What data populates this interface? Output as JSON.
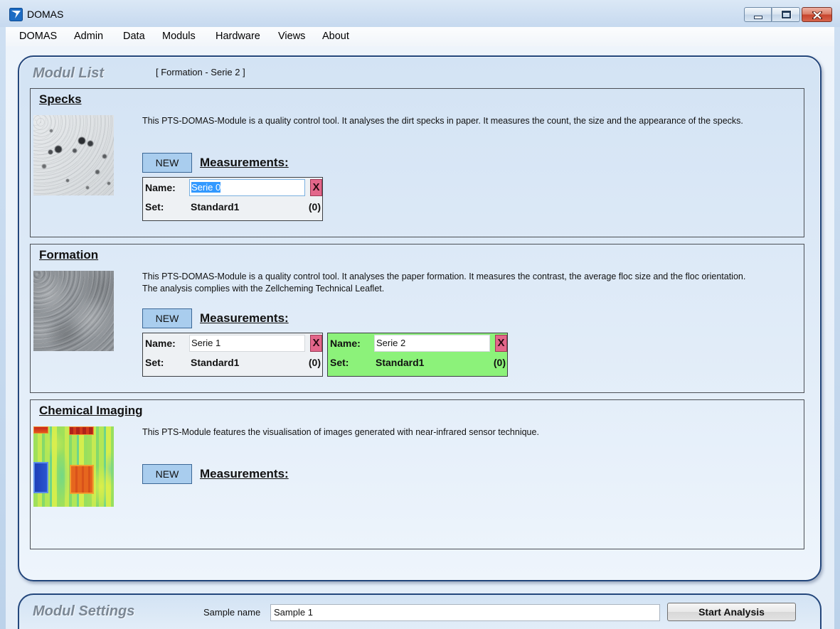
{
  "window": {
    "title": "DOMAS",
    "icon": "domas-logo-icon",
    "controls": [
      "minimize-icon",
      "maximize-icon",
      "close-icon"
    ]
  },
  "menu": {
    "items": [
      "DOMAS",
      "Admin",
      "Data",
      "Moduls",
      "Hardware",
      "Views",
      "About"
    ]
  },
  "modul_list": {
    "title": "Modul List",
    "context": "[ Formation - Serie 2 ]",
    "modules": [
      {
        "name": "Specks",
        "thumbnail": "specks-sample-image",
        "description_lines": [
          "This PTS-DOMAS-Module is a quality control tool. It analyses the dirt specks in paper. It measures the count, the size and the appearance of the specks."
        ],
        "new_label": "NEW",
        "measurements_label": "Measurements:",
        "measurements": [
          {
            "name_label": "Name:",
            "name_value": "Serie 0",
            "set_label": "Set:",
            "set_value": "Standard1",
            "count": "(0)",
            "delete_label": "X",
            "selected": false,
            "text_highlighted": true
          }
        ]
      },
      {
        "name": "Formation",
        "thumbnail": "formation-sample-image",
        "description_lines": [
          "This PTS-DOMAS-Module is a quality control tool. It analyses the paper formation. It measures the contrast, the average floc size and the floc orientation.",
          "The analysis complies with the Zellcheming Technical Leaflet."
        ],
        "new_label": "NEW",
        "measurements_label": "Measurements:",
        "measurements": [
          {
            "name_label": "Name:",
            "name_value": "Serie 1",
            "set_label": "Set:",
            "set_value": "Standard1",
            "count": "(0)",
            "delete_label": "X",
            "selected": false,
            "text_highlighted": false
          },
          {
            "name_label": "Name:",
            "name_value": "Serie 2",
            "set_label": "Set:",
            "set_value": "Standard1",
            "count": "(0)",
            "delete_label": "X",
            "selected": true,
            "text_highlighted": false
          }
        ]
      },
      {
        "name": "Chemical Imaging",
        "thumbnail": "chemical-imaging-heatmap-image",
        "description_lines": [
          "This PTS-Module features the visualisation of images generated with near-infrared sensor technique."
        ],
        "new_label": "NEW",
        "measurements_label": "Measurements:",
        "measurements": []
      }
    ]
  },
  "modul_settings": {
    "title": "Modul Settings",
    "sample_name_label": "Sample name",
    "sample_name_value": "Sample 1",
    "start_button_label": "Start Analysis"
  },
  "colors": {
    "panel_border": "#24477c",
    "selected_measurement": "#8cf27a",
    "delete_button": "#e3668a",
    "new_button": "#a9cdee",
    "text_selection": "#3399ff"
  }
}
